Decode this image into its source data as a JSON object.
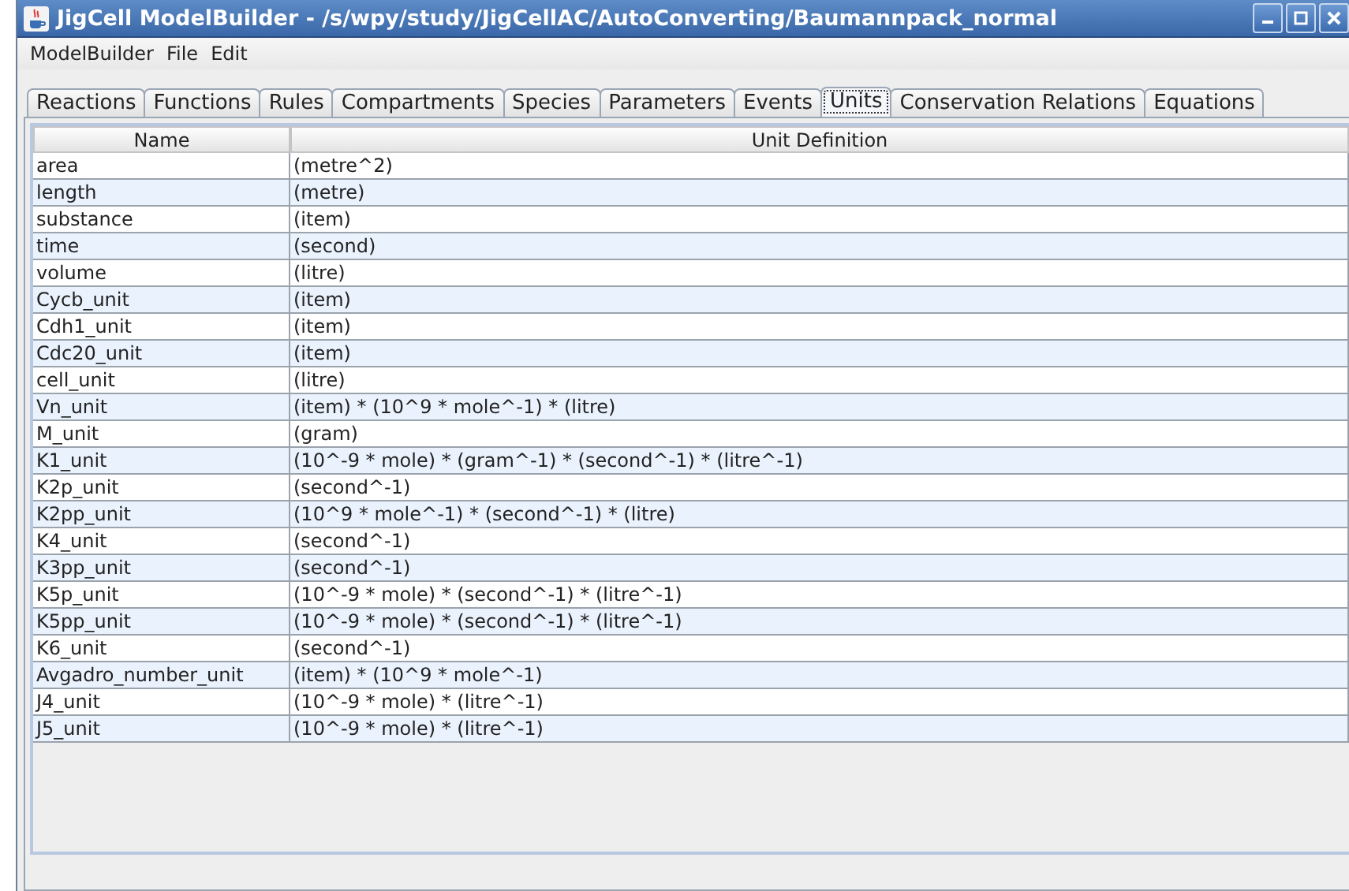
{
  "window": {
    "title": "JigCell ModelBuilder - /s/wpy/study/JigCellAC/AutoConverting/Baumannpack_normal"
  },
  "menu": [
    "ModelBuilder",
    "File",
    "Edit"
  ],
  "tabs": [
    {
      "label": "Reactions",
      "selected": false
    },
    {
      "label": "Functions",
      "selected": false
    },
    {
      "label": "Rules",
      "selected": false
    },
    {
      "label": "Compartments",
      "selected": false
    },
    {
      "label": "Species",
      "selected": false
    },
    {
      "label": "Parameters",
      "selected": false
    },
    {
      "label": "Events",
      "selected": false
    },
    {
      "label": "Units",
      "selected": true
    },
    {
      "label": "Conservation Relations",
      "selected": false
    },
    {
      "label": "Equations",
      "selected": false
    }
  ],
  "table": {
    "columns": [
      "Name",
      "Unit Definition"
    ],
    "rows": [
      [
        "area",
        "(metre^2)"
      ],
      [
        "length",
        "(metre)"
      ],
      [
        "substance",
        "(item)"
      ],
      [
        "time",
        "(second)"
      ],
      [
        "volume",
        "(litre)"
      ],
      [
        "Cycb_unit",
        "(item)"
      ],
      [
        "Cdh1_unit",
        "(item)"
      ],
      [
        "Cdc20_unit",
        "(item)"
      ],
      [
        "cell_unit",
        "(litre)"
      ],
      [
        "Vn_unit",
        "(item) * (10^9 * mole^-1) * (litre)"
      ],
      [
        "M_unit",
        "(gram)"
      ],
      [
        "K1_unit",
        "(10^-9 * mole) * (gram^-1) * (second^-1) * (litre^-1)"
      ],
      [
        "K2p_unit",
        "(second^-1)"
      ],
      [
        "K2pp_unit",
        "(10^9 * mole^-1) * (second^-1) * (litre)"
      ],
      [
        "K4_unit",
        "(second^-1)"
      ],
      [
        "K3pp_unit",
        "(second^-1)"
      ],
      [
        "K5p_unit",
        "(10^-9 * mole) * (second^-1) * (litre^-1)"
      ],
      [
        "K5pp_unit",
        "(10^-9 * mole) * (second^-1) * (litre^-1)"
      ],
      [
        "K6_unit",
        "(second^-1)"
      ],
      [
        "Avgadro_number_unit",
        "(item) * (10^9 * mole^-1)"
      ],
      [
        "J4_unit",
        "(10^-9 * mole) * (litre^-1)"
      ],
      [
        "J5_unit",
        "(10^-9 * mole) * (litre^-1)"
      ]
    ]
  }
}
